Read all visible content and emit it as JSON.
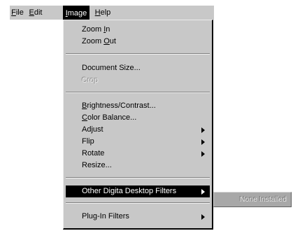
{
  "menubar": {
    "items": [
      {
        "label_first": "F",
        "label_rest": "ile",
        "state": "normal"
      },
      {
        "label_first": "E",
        "label_rest": "dit",
        "state": "normal"
      },
      {
        "label_first": "I",
        "label_rest": "mage",
        "state": "open"
      },
      {
        "label_first": "H",
        "label_rest": "elp",
        "state": "normal"
      }
    ]
  },
  "image_menu": {
    "items": [
      {
        "before": "Zoom ",
        "mnemonic": "I",
        "after": "n",
        "enabled": true,
        "submenu": false
      },
      {
        "before": "Zoom ",
        "mnemonic": "O",
        "after": "ut",
        "enabled": true,
        "submenu": false
      },
      {
        "before": "Document Size...",
        "mnemonic": "",
        "after": "",
        "enabled": true,
        "submenu": false
      },
      {
        "before": "Crop",
        "mnemonic": "",
        "after": "",
        "enabled": false,
        "submenu": false
      },
      {
        "before": "",
        "mnemonic": "B",
        "after": "rightness/Contrast...",
        "enabled": true,
        "submenu": false
      },
      {
        "before": "",
        "mnemonic": "C",
        "after": "olor Balance...",
        "enabled": true,
        "submenu": false
      },
      {
        "before": "Adjust",
        "mnemonic": "",
        "after": "",
        "enabled": true,
        "submenu": true
      },
      {
        "before": "Flip",
        "mnemonic": "",
        "after": "",
        "enabled": true,
        "submenu": true
      },
      {
        "before": "Rotate",
        "mnemonic": "",
        "after": "",
        "enabled": true,
        "submenu": true
      },
      {
        "before": "Resize...",
        "mnemonic": "",
        "after": "",
        "enabled": true,
        "submenu": false
      },
      {
        "before": "Other Digita Desktop Filters",
        "mnemonic": "",
        "after": "",
        "enabled": true,
        "submenu": true,
        "highlighted": true
      },
      {
        "before": "Plug-In Filters",
        "mnemonic": "",
        "after": "",
        "enabled": true,
        "submenu": true
      }
    ]
  },
  "submenu": {
    "items": [
      {
        "label": "None Installed",
        "enabled": false
      }
    ]
  }
}
